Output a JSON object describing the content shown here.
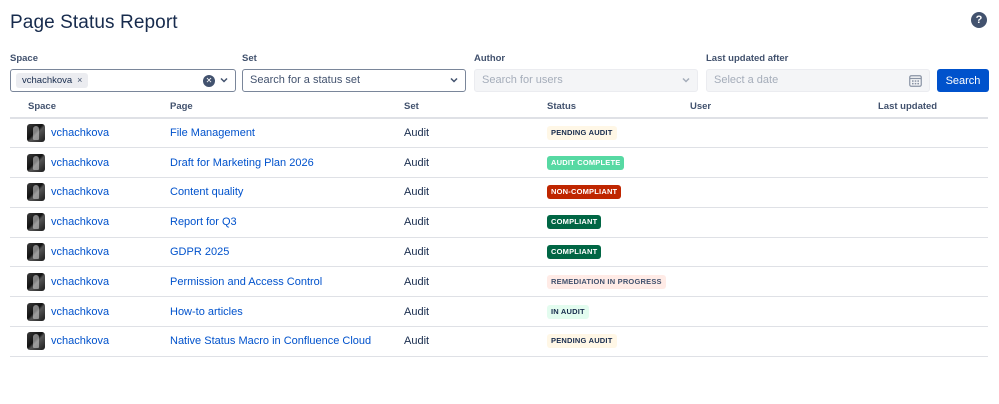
{
  "header": {
    "title": "Page Status Report",
    "help_icon": "question-circle-icon",
    "help_glyph": "?"
  },
  "filters": {
    "space": {
      "label": "Space",
      "chip": "vchachkova",
      "chip_remove": "×",
      "clear_glyph": "✕"
    },
    "set": {
      "label": "Set",
      "placeholder": "Search for a status set"
    },
    "author": {
      "label": "Author",
      "placeholder": "Search for users"
    },
    "last_updated": {
      "label": "Last updated after",
      "placeholder": "Select a date"
    },
    "search_label": "Search"
  },
  "table": {
    "columns": {
      "space": "Space",
      "page": "Page",
      "set": "Set",
      "status": "Status",
      "user": "User",
      "last_updated": "Last updated"
    },
    "rows": [
      {
        "space": "vchachkova",
        "page": "File Management",
        "set": "Audit",
        "status": "PENDING AUDIT",
        "status_bg": "#fff7e6",
        "status_fg": "#172b4d"
      },
      {
        "space": "vchachkova",
        "page": "Draft for Marketing Plan 2026",
        "set": "Audit",
        "status": "AUDIT COMPLETE",
        "status_bg": "#57d9a3",
        "status_fg": "#ffffff"
      },
      {
        "space": "vchachkova",
        "page": "Content quality",
        "set": "Audit",
        "status": "NON-COMPLIANT",
        "status_bg": "#bf2600",
        "status_fg": "#ffffff"
      },
      {
        "space": "vchachkova",
        "page": "Report for Q3",
        "set": "Audit",
        "status": "COMPLIANT",
        "status_bg": "#006644",
        "status_fg": "#ffffff"
      },
      {
        "space": "vchachkova",
        "page": "GDPR 2025",
        "set": "Audit",
        "status": "COMPLIANT",
        "status_bg": "#006644",
        "status_fg": "#ffffff"
      },
      {
        "space": "vchachkova",
        "page": "Permission and Access Control",
        "set": "Audit",
        "status": "REMEDIATION IN PROGRESS",
        "status_bg": "#ffebe6",
        "status_fg": "#42526e"
      },
      {
        "space": "vchachkova",
        "page": "How-to articles",
        "set": "Audit",
        "status": "IN AUDIT",
        "status_bg": "#e3fcef",
        "status_fg": "#172b4d"
      },
      {
        "space": "vchachkova",
        "page": "Native Status Macro in Confluence Cloud",
        "set": "Audit",
        "status": "PENDING AUDIT",
        "status_bg": "#fff7e6",
        "status_fg": "#172b4d"
      }
    ]
  },
  "colors": {
    "primary": "#0052cc",
    "text": "#172b4d",
    "muted": "#42526e",
    "border": "#dfe1e6"
  }
}
